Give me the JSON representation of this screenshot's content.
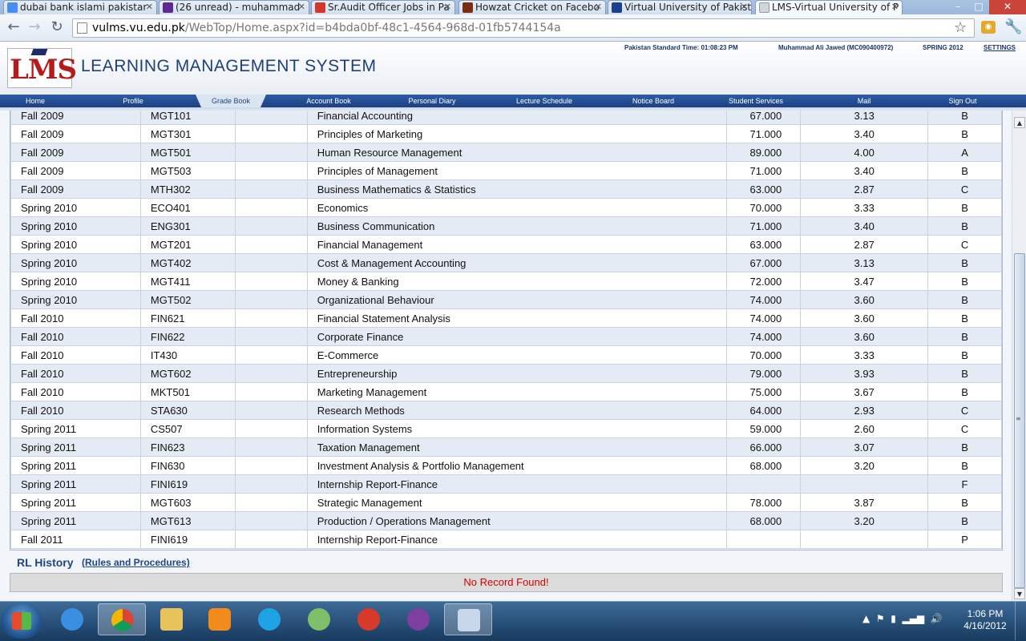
{
  "browser": {
    "tabs": [
      {
        "title": "dubai bank islami pakistar",
        "icon": "google-icon",
        "color": "#4a8df0"
      },
      {
        "title": "(26 unread) - muhammad",
        "icon": "yahoo-mail-icon",
        "color": "#5f2a8f"
      },
      {
        "title": "Sr.Audit Officer Jobs in Pa",
        "icon": "rozee-icon",
        "color": "#d3362a"
      },
      {
        "title": "Howzat Cricket on Facebo",
        "icon": "howzat-icon",
        "color": "#7a2d14"
      },
      {
        "title": "Virtual University of Pakist",
        "icon": "vu-icon",
        "color": "#1c3f8f"
      },
      {
        "title": "LMS-Virtual University of P",
        "icon": "page-icon",
        "color": "#d0d6de"
      }
    ],
    "url_host": "vulms.vu.edu.pk",
    "url_path": "/WebTop/Home.aspx?id=b4bda0bf-48c1-4564-968d-01fb5744154a"
  },
  "header": {
    "logo": "LMS",
    "title": "LEARNING MANAGEMENT SYSTEM",
    "time": "Pakistan Standard Time: 01:08:23  PM",
    "user": "Muhammad Ali Jawed (MC090400972)",
    "semester": "SPRING 2012",
    "settings": "SETTINGS"
  },
  "nav": [
    "Home",
    "Profile",
    "Grade Book",
    "Account Book",
    "Personal Diary",
    "Lecture Schedule",
    "Notice Board",
    "Student Services",
    "Mail",
    "Sign Out"
  ],
  "grades": [
    [
      "Fall 2009",
      "MGT101",
      "",
      "Financial Accounting",
      "67.000",
      "3.13",
      "B"
    ],
    [
      "Fall 2009",
      "MGT301",
      "",
      "Principles of Marketing",
      "71.000",
      "3.40",
      "B"
    ],
    [
      "Fall 2009",
      "MGT501",
      "",
      "Human Resource Management",
      "89.000",
      "4.00",
      "A"
    ],
    [
      "Fall 2009",
      "MGT503",
      "",
      "Principles of Management",
      "71.000",
      "3.40",
      "B"
    ],
    [
      "Fall 2009",
      "MTH302",
      "",
      "Business Mathematics & Statistics",
      "63.000",
      "2.87",
      "C"
    ],
    [
      "Spring 2010",
      "ECO401",
      "",
      "Economics",
      "70.000",
      "3.33",
      "B"
    ],
    [
      "Spring 2010",
      "ENG301",
      "",
      "Business Communication",
      "71.000",
      "3.40",
      "B"
    ],
    [
      "Spring 2010",
      "MGT201",
      "",
      "Financial Management",
      "63.000",
      "2.87",
      "C"
    ],
    [
      "Spring 2010",
      "MGT402",
      "",
      "Cost & Management Accounting",
      "67.000",
      "3.13",
      "B"
    ],
    [
      "Spring 2010",
      "MGT411",
      "",
      "Money & Banking",
      "72.000",
      "3.47",
      "B"
    ],
    [
      "Spring 2010",
      "MGT502",
      "",
      "Organizational Behaviour",
      "74.000",
      "3.60",
      "B"
    ],
    [
      "Fall 2010",
      "FIN621",
      "",
      "Financial Statement Analysis",
      "74.000",
      "3.60",
      "B"
    ],
    [
      "Fall 2010",
      "FIN622",
      "",
      "Corporate Finance",
      "74.000",
      "3.60",
      "B"
    ],
    [
      "Fall 2010",
      "IT430",
      "",
      "E-Commerce",
      "70.000",
      "3.33",
      "B"
    ],
    [
      "Fall 2010",
      "MGT602",
      "",
      "Entrepreneurship",
      "79.000",
      "3.93",
      "B"
    ],
    [
      "Fall 2010",
      "MKT501",
      "",
      "Marketing Management",
      "75.000",
      "3.67",
      "B"
    ],
    [
      "Fall 2010",
      "STA630",
      "",
      "Research Methods",
      "64.000",
      "2.93",
      "C"
    ],
    [
      "Spring 2011",
      "CS507",
      "",
      "Information Systems",
      "59.000",
      "2.60",
      "C"
    ],
    [
      "Spring 2011",
      "FIN623",
      "",
      "Taxation Management",
      "66.000",
      "3.07",
      "B"
    ],
    [
      "Spring 2011",
      "FIN630",
      "",
      "Investment Analysis & Portfolio Management",
      "68.000",
      "3.20",
      "B"
    ],
    [
      "Spring 2011",
      "FINI619",
      "",
      "Internship Report-Finance",
      "",
      "",
      "F"
    ],
    [
      "Spring 2011",
      "MGT603",
      "",
      "Strategic Management",
      "78.000",
      "3.87",
      "B"
    ],
    [
      "Spring 2011",
      "MGT613",
      "",
      "Production / Operations Management",
      "68.000",
      "3.20",
      "B"
    ],
    [
      "Fall 2011",
      "FINI619",
      "",
      "Internship Report-Finance",
      "",
      "",
      "P"
    ]
  ],
  "rl": {
    "title": "RL History",
    "link": "(Rules and Procedures)",
    "empty": "No Record Found!"
  },
  "taskbar": {
    "apps": [
      "start-button",
      "ie-icon",
      "chrome-icon",
      "explorer-icon",
      "media-player-icon",
      "skype-icon",
      "chat-icon",
      "ccleaner-icon",
      "yahoo-messenger-icon",
      "paint-icon"
    ],
    "time": "1:06 PM",
    "date": "4/16/2012"
  }
}
